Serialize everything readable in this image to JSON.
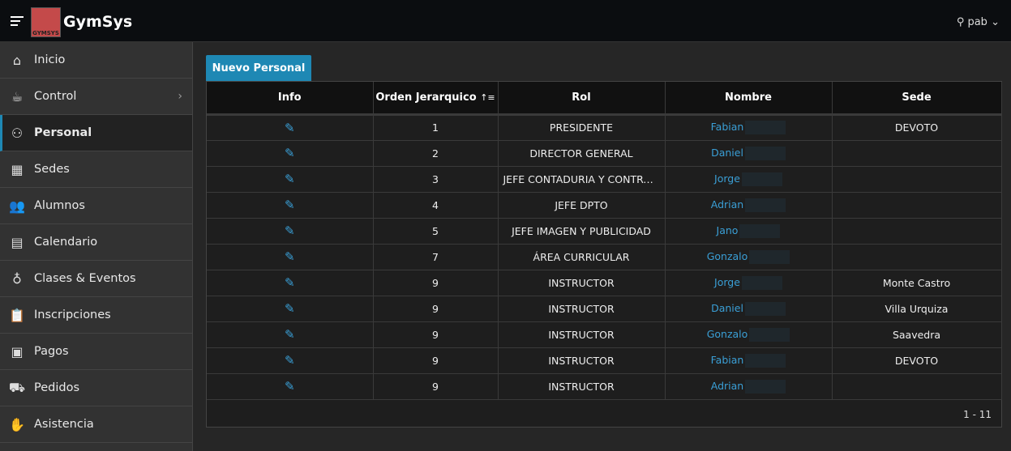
{
  "header": {
    "app_title": "GymSys",
    "logo_text": "GYMSYS",
    "user": "pab"
  },
  "sidebar": {
    "items": [
      {
        "label": "Inicio",
        "icon": "⌂"
      },
      {
        "label": "Control",
        "icon": "☕",
        "chevron": true
      },
      {
        "label": "Personal",
        "icon": "⚇",
        "active": true
      },
      {
        "label": "Sedes",
        "icon": "▦"
      },
      {
        "label": "Alumnos",
        "icon": "👥"
      },
      {
        "label": "Calendario",
        "icon": "▤"
      },
      {
        "label": "Clases & Eventos",
        "icon": "♁"
      },
      {
        "label": "Inscripciones",
        "icon": "📋"
      },
      {
        "label": "Pagos",
        "icon": "▣"
      },
      {
        "label": "Pedidos",
        "icon": "⛟"
      },
      {
        "label": "Asistencia",
        "icon": "✋"
      }
    ]
  },
  "main": {
    "new_button": "Nuevo Personal",
    "columns": [
      "Info",
      "Orden Jerarquico",
      "Rol",
      "Nombre",
      "Sede"
    ],
    "sort_icon": "↑≡",
    "rows": [
      {
        "orden": "1",
        "rol": "PRESIDENTE",
        "nombre": "Fabian",
        "sede": "DEVOTO"
      },
      {
        "orden": "2",
        "rol": "DIRECTOR GENERAL",
        "nombre": "Daniel",
        "sede": ""
      },
      {
        "orden": "3",
        "rol": "JEFE CONTADURIA Y CONTRA...",
        "nombre": "Jorge",
        "sede": ""
      },
      {
        "orden": "4",
        "rol": "JEFE DPTO",
        "nombre": "Adrian",
        "sede": ""
      },
      {
        "orden": "5",
        "rol": "JEFE IMAGEN Y PUBLICIDAD",
        "nombre": "Jano",
        "sede": ""
      },
      {
        "orden": "7",
        "rol": "ÁREA CURRICULAR",
        "nombre": "Gonzalo",
        "sede": ""
      },
      {
        "orden": "9",
        "rol": "INSTRUCTOR",
        "nombre": "Jorge",
        "sede": "Monte Castro"
      },
      {
        "orden": "9",
        "rol": "INSTRUCTOR",
        "nombre": "Daniel",
        "sede": "Villa Urquiza"
      },
      {
        "orden": "9",
        "rol": "INSTRUCTOR",
        "nombre": "Gonzalo",
        "sede": "Saavedra"
      },
      {
        "orden": "9",
        "rol": "INSTRUCTOR",
        "nombre": "Fabian",
        "sede": "DEVOTO"
      },
      {
        "orden": "9",
        "rol": "INSTRUCTOR",
        "nombre": "Adrian",
        "sede": ""
      }
    ],
    "pagination": "1 - 11"
  }
}
